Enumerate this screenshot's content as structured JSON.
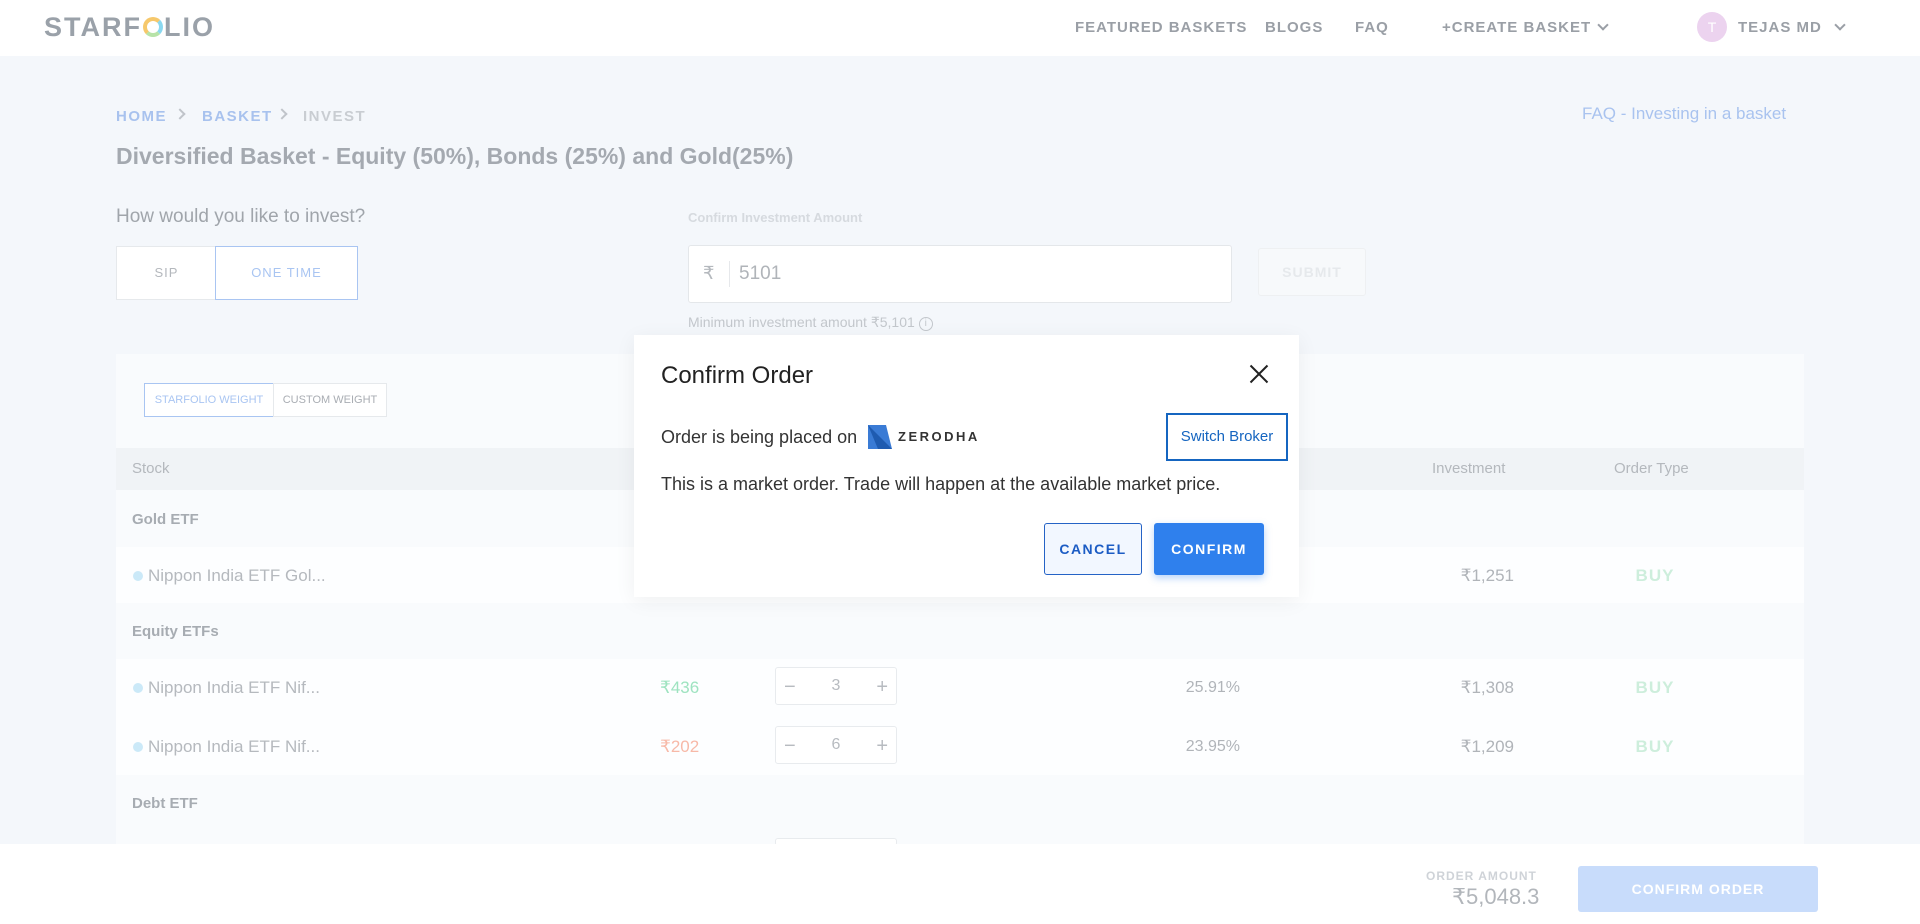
{
  "header": {
    "logo": "STARFOLIO",
    "nav": [
      "FEATURED BASKETS",
      "BLOGS",
      "FAQ",
      "+CREATE BASKET"
    ],
    "user": {
      "initial": "T",
      "name": "TEJAS MD"
    }
  },
  "breadcrumb": [
    "HOME",
    "BASKET",
    "INVEST"
  ],
  "faq_link": "FAQ - Investing in a basket",
  "page_title": "Diversified Basket - Equity (50%), Bonds (25%) and Gold(25%)",
  "invest": {
    "question": "How would you like to invest?",
    "options": [
      "SIP",
      "ONE TIME"
    ],
    "selected": "ONE TIME",
    "amount_label": "Confirm Investment Amount",
    "currency": "₹",
    "amount": "5101",
    "submit": "SUBMIT",
    "min_label": "Minimum investment amount",
    "min_value": "₹5,101",
    "info_icon": "info-icon"
  },
  "weights": {
    "options": [
      "STARFOLIO WEIGHT",
      "CUSTOM WEIGHT"
    ],
    "selected": "STARFOLIO WEIGHT"
  },
  "table": {
    "headers": {
      "stock": "Stock",
      "investment": "Investment",
      "order_type": "Order Type"
    },
    "groups": [
      {
        "name": "Gold ETF",
        "rows": [
          {
            "stock": "Nippon India ETF Gol...",
            "investment": "₹1,251",
            "order": "BUY"
          }
        ]
      },
      {
        "name": "Equity ETFs",
        "rows": [
          {
            "stock": "Nippon India ETF Nif...",
            "price": "₹436",
            "qty": "3",
            "weight": "25.91%",
            "investment": "₹1,308",
            "order": "BUY"
          },
          {
            "stock": "Nippon India ETF Nif...",
            "price": "₹202",
            "qty": "6",
            "weight": "23.95%",
            "investment": "₹1,209",
            "order": "BUY"
          }
        ]
      },
      {
        "name": "Debt ETF",
        "rows": []
      }
    ]
  },
  "footer": {
    "order_amount_label": "ORDER AMOUNT",
    "order_amount": "₹5,048.3",
    "confirm_order": "CONFIRM ORDER"
  },
  "modal": {
    "title": "Confirm Order",
    "placed_on": "Order is being placed on",
    "broker": "ZERODHA",
    "switch_broker": "Switch Broker",
    "message": "This is a market order. Trade will happen at the available market price.",
    "cancel": "CANCEL",
    "confirm": "CONFIRM"
  },
  "colors": {
    "accent": "#2f80ed",
    "switch_border": "#1565c0",
    "price_up": "#9ee3c0",
    "price_down": "#f7b9a8",
    "buy": "#cdeedc"
  }
}
